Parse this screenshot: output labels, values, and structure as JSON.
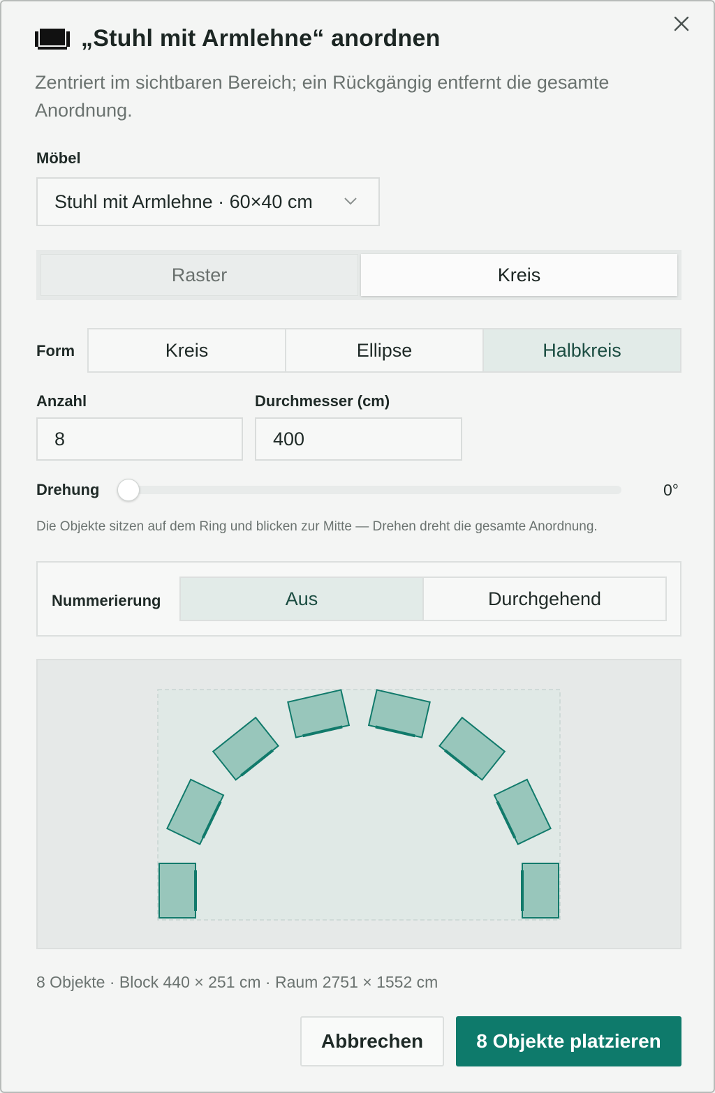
{
  "dialog": {
    "title": "„Stuhl mit Armlehne“ anordnen",
    "subtitle": "Zentriert im sichtbaren Bereich; ein Rückgängig entfernt die gesamte Anordnung.",
    "title_icon": "sofa-icon",
    "close_icon": "close-icon"
  },
  "furniture": {
    "label": "Möbel",
    "selected": "Stuhl mit Armlehne · 60×40 cm"
  },
  "mode_tabs": [
    {
      "label": "Raster",
      "active": false
    },
    {
      "label": "Kreis",
      "active": true
    }
  ],
  "shape": {
    "label": "Form",
    "options": [
      "Kreis",
      "Ellipse",
      "Halbkreis"
    ],
    "selected": "Halbkreis"
  },
  "count": {
    "label": "Anzahl",
    "value": "8"
  },
  "diameter": {
    "label": "Durchmesser (cm)",
    "value": "400"
  },
  "rotation": {
    "label": "Drehung",
    "value": "0°",
    "level": 0
  },
  "hint": "Die Objekte sitzen auf dem Ring und blicken zur Mitte — Drehen dreht die gesamte Anordnung.",
  "numbering": {
    "label": "Nummerierung",
    "options": [
      "Aus",
      "Durchgehend"
    ],
    "selected": "Aus"
  },
  "preview": {
    "chair_count": 8,
    "arrangement": "Halbkreis",
    "colors": {
      "fill": "#98c6bb",
      "stroke": "#117a6b",
      "area": "#e0e9e6"
    }
  },
  "summary": "8 Objekte · Block 440 × 251 cm · Raum 2751 × 1552 cm",
  "buttons": {
    "cancel": "Abbrechen",
    "confirm": "8 Objekte platzieren"
  },
  "colors": {
    "accent": "#0e7a6b",
    "selected_bg": "#e2ebe8"
  }
}
